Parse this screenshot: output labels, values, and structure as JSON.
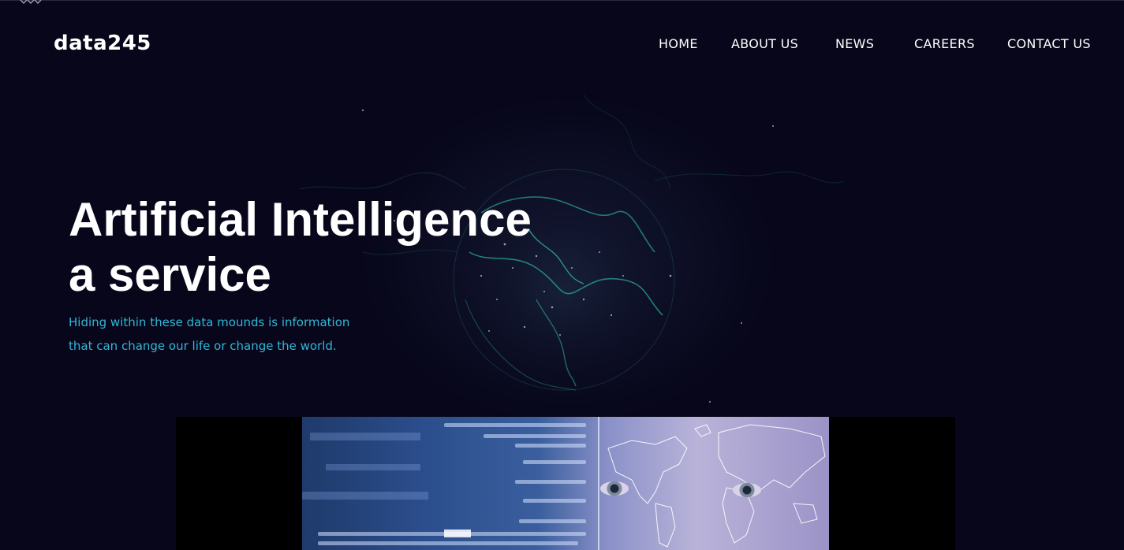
{
  "brand": {
    "logo_text": "data245"
  },
  "nav": {
    "items": [
      {
        "label": "HOME"
      },
      {
        "label": "ABOUT US"
      },
      {
        "label": "NEWS"
      },
      {
        "label": "CAREERS"
      },
      {
        "label": "CONTACT US"
      }
    ]
  },
  "hero": {
    "title_line1": "Artificial Intelligence",
    "title_line2": "a service",
    "subtitle_line1": "Hiding within these data mounds is information",
    "subtitle_line2": "that can change our life or change the world."
  },
  "colors": {
    "background": "#07061a",
    "accent": "#2fb8d8",
    "text": "#ffffff"
  }
}
